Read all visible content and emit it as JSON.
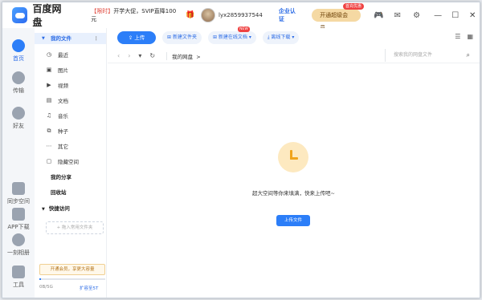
{
  "title": "百度网盘",
  "promo": {
    "tag": "【限时】",
    "text": "开学大促，SVIP直降100元"
  },
  "user": {
    "name": "lyx2859937544"
  },
  "header": {
    "certify": "企业认证",
    "vip_button": "开通超级会员",
    "vip_tag": "首充优惠"
  },
  "leftnav": [
    {
      "label": "首页"
    },
    {
      "label": "传输"
    },
    {
      "label": "好友"
    },
    {
      "label": "同步空间"
    },
    {
      "label": "APP下载"
    },
    {
      "label": "一刻相册"
    },
    {
      "label": "工具"
    }
  ],
  "sidebar": {
    "head": "我的文件",
    "items": [
      {
        "label": "最近",
        "icon": "clock-icon"
      },
      {
        "label": "图片",
        "icon": "image-icon"
      },
      {
        "label": "视频",
        "icon": "video-icon"
      },
      {
        "label": "文档",
        "icon": "document-icon"
      },
      {
        "label": "音乐",
        "icon": "music-icon"
      },
      {
        "label": "种子",
        "icon": "torrent-icon"
      },
      {
        "label": "其它",
        "icon": "more-icon"
      },
      {
        "label": "隐藏空间",
        "icon": "lock-icon"
      }
    ],
    "my_share": "我的分享",
    "recycle": "回收站",
    "quick_access": "快捷访问",
    "add_quick": "+ 拖入常用文件夹",
    "vip_banner": "开通会员，享更大容量",
    "quota": "0B/5G",
    "quota_fraction": 0.03,
    "expand": "扩容至5T"
  },
  "toolbar": {
    "upload": "上传",
    "new_folder": "新建文件夹",
    "new_online_doc": "新建在线文档",
    "new_tag": "NEW",
    "offline_download": "离线下载"
  },
  "path": {
    "current": "我的网盘",
    "search_placeholder": "搜索我的网盘文件"
  },
  "empty": {
    "message": "超大空间等你来填满，快来上传吧~",
    "button": "上传文件"
  },
  "colors": {
    "accent": "#2c7ef8",
    "vip": "#f5d9a3",
    "warning": "#f0a41c"
  }
}
